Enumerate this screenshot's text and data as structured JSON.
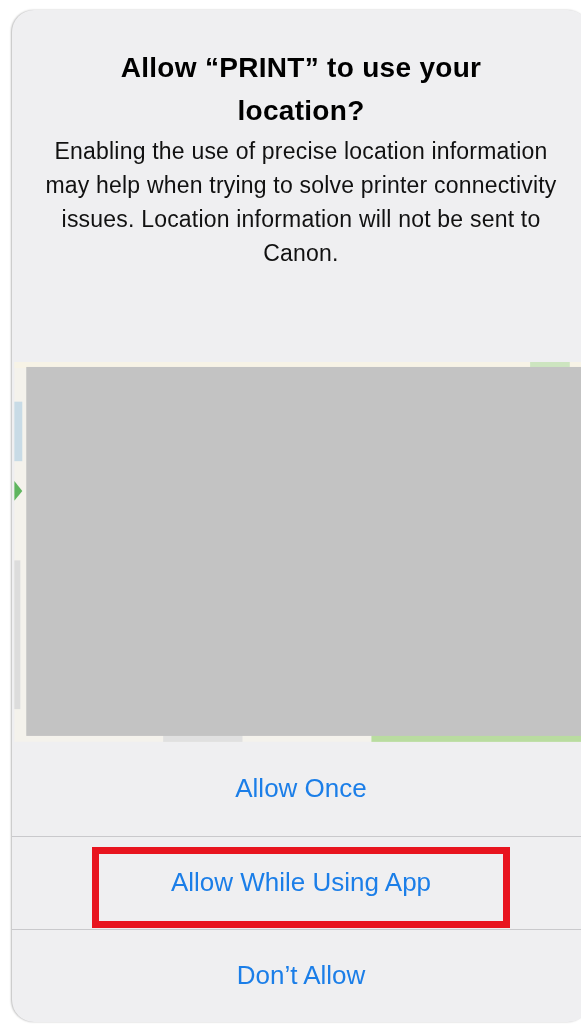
{
  "dialog": {
    "title": "Allow “PRINT” to use your location?",
    "message": "Enabling the use of precise location information may help when trying to solve printer connectivity issues. Location information will not be sent to Canon.",
    "buttons": [
      {
        "label": "Allow Once",
        "highlighted": false
      },
      {
        "label": "Allow While Using App",
        "highlighted": true
      },
      {
        "label": "Don’t Allow",
        "highlighted": false
      }
    ]
  }
}
